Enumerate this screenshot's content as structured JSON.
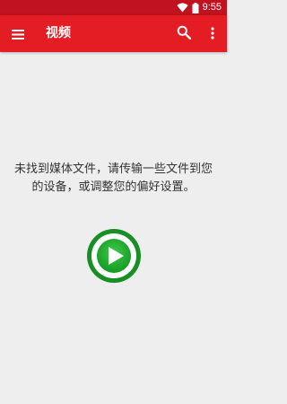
{
  "status_bar": {
    "time": "9:55",
    "icons": [
      "wifi-icon",
      "battery-icon"
    ]
  },
  "app_bar": {
    "title": "视频",
    "menu_icon": "menu-icon",
    "search_icon": "search-icon",
    "more_icon": "more-vert-icon"
  },
  "empty_state": {
    "line1": "未找到媒体文件，请传输一些文件到您",
    "line2": "的设备，或调整您的偏好设置。",
    "action_icon": "play-icon"
  },
  "colors": {
    "status_bar": "#c1121f",
    "app_bar": "#e41c23",
    "background": "#eeeeee",
    "play_green": "#1fa22e"
  }
}
